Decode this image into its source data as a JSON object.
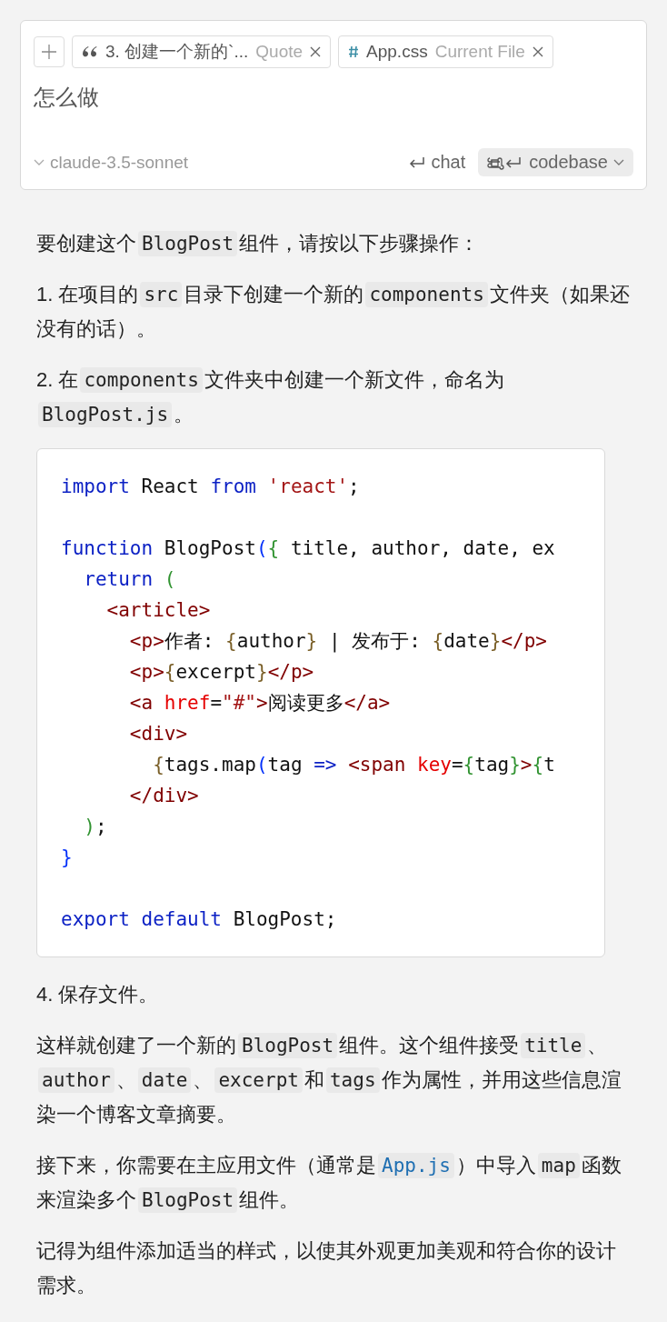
{
  "composer": {
    "chips": [
      {
        "kind": "quote",
        "label": "3. 创建一个新的`...",
        "tag": "Quote"
      },
      {
        "kind": "file",
        "label": "App.css",
        "tag": "Current File"
      }
    ],
    "message": "怎么做",
    "model": "claude-3.5-sonnet",
    "chat": "chat",
    "codebase": "codebase"
  },
  "paragraphs_before": [
    [
      {
        "kind": "text",
        "text": "要创建这个"
      },
      {
        "kind": "code",
        "text": "BlogPost"
      },
      {
        "kind": "text",
        "text": "组件，请按以下步骤操作："
      }
    ],
    [
      {
        "kind": "text",
        "text": "1. 在项目的"
      },
      {
        "kind": "code",
        "text": "src"
      },
      {
        "kind": "text",
        "text": "目录下创建一个新的"
      },
      {
        "kind": "code",
        "text": "components"
      },
      {
        "kind": "text",
        "text": "文件夹（如果还没有的话）。"
      }
    ],
    [
      {
        "kind": "text",
        "text": "2. 在"
      },
      {
        "kind": "code",
        "text": "components"
      },
      {
        "kind": "text",
        "text": "文件夹中创建一个新文件，命名为"
      },
      {
        "kind": "code",
        "text": "BlogPost.js"
      },
      {
        "kind": "text",
        "text": "。"
      }
    ]
  ],
  "code_blocks": [
    [
      [
        {
          "kind": "kw",
          "text": "import"
        },
        {
          "kind": "plain",
          "text": " React "
        },
        {
          "kind": "kw",
          "text": "from"
        },
        {
          "kind": "str",
          "text": " 'react'"
        },
        {
          "kind": "plain",
          "text": ";"
        }
      ]
    ],
    [
      [
        {
          "kind": "kw",
          "text": "function"
        },
        {
          "kind": "plain",
          "text": " BlogPost"
        },
        {
          "kind": "blue",
          "text": "("
        },
        {
          "kind": "green",
          "text": "{"
        },
        {
          "kind": "plain",
          "text": " title, author, date, ex"
        }
      ],
      [
        {
          "kind": "kw",
          "text": "  return"
        },
        {
          "kind": "green",
          "text": " ("
        }
      ],
      [
        {
          "kind": "tag",
          "text": "    <article>"
        }
      ],
      [
        {
          "kind": "tag",
          "text": "      <p>"
        },
        {
          "kind": "plain",
          "text": "作者: "
        },
        {
          "kind": "gold",
          "text": "{"
        },
        {
          "kind": "plain",
          "text": "author"
        },
        {
          "kind": "gold",
          "text": "}"
        },
        {
          "kind": "plain",
          "text": " | 发布于: "
        },
        {
          "kind": "gold",
          "text": "{"
        },
        {
          "kind": "plain",
          "text": "date"
        },
        {
          "kind": "gold",
          "text": "}"
        },
        {
          "kind": "tag",
          "text": "</p>"
        }
      ],
      [
        {
          "kind": "tag",
          "text": "      <p>"
        },
        {
          "kind": "gold",
          "text": "{"
        },
        {
          "kind": "plain",
          "text": "excerpt"
        },
        {
          "kind": "gold",
          "text": "}"
        },
        {
          "kind": "tag",
          "text": "</p>"
        }
      ],
      [
        {
          "kind": "tag",
          "text": "      <a"
        },
        {
          "kind": "attr",
          "text": " href"
        },
        {
          "kind": "plain",
          "text": "="
        },
        {
          "kind": "str",
          "text": "\"#\""
        },
        {
          "kind": "tag",
          "text": ">"
        },
        {
          "kind": "plain",
          "text": "阅读更多"
        },
        {
          "kind": "tag",
          "text": "</a>"
        }
      ],
      [
        {
          "kind": "tag",
          "text": "      <div>"
        }
      ],
      [
        {
          "kind": "gold",
          "text": "        {"
        },
        {
          "kind": "plain",
          "text": "tags.map"
        },
        {
          "kind": "blue",
          "text": "("
        },
        {
          "kind": "plain",
          "text": "tag"
        },
        {
          "kind": "kw",
          "text": " =>"
        },
        {
          "kind": "tag",
          "text": " <span"
        },
        {
          "kind": "attr",
          "text": " key"
        },
        {
          "kind": "plain",
          "text": "="
        },
        {
          "kind": "green",
          "text": "{"
        },
        {
          "kind": "plain",
          "text": "tag"
        },
        {
          "kind": "green",
          "text": "}"
        },
        {
          "kind": "tag",
          "text": ">"
        },
        {
          "kind": "green",
          "text": "{"
        },
        {
          "kind": "plain",
          "text": "t"
        }
      ],
      [
        {
          "kind": "tag",
          "text": "      </div>"
        }
      ],
      [
        {
          "kind": "green",
          "text": "  )"
        },
        {
          "kind": "plain",
          "text": ";"
        }
      ],
      [
        {
          "kind": "blue",
          "text": "}"
        }
      ]
    ],
    [
      [
        {
          "kind": "kw",
          "text": "export"
        },
        {
          "kind": "kw",
          "text": " default"
        },
        {
          "kind": "plain",
          "text": " BlogPost;"
        }
      ]
    ]
  ],
  "paragraphs_after": [
    [
      {
        "kind": "text",
        "text": "4. 保存文件。"
      }
    ],
    [
      {
        "kind": "text",
        "text": "这样就创建了一个新的"
      },
      {
        "kind": "code",
        "text": "BlogPost"
      },
      {
        "kind": "text",
        "text": "组件。这个组件接受"
      },
      {
        "kind": "code",
        "text": "title"
      },
      {
        "kind": "text",
        "text": "、"
      },
      {
        "kind": "code",
        "text": "author"
      },
      {
        "kind": "text",
        "text": "、"
      },
      {
        "kind": "code",
        "text": "date"
      },
      {
        "kind": "text",
        "text": "、"
      },
      {
        "kind": "code",
        "text": "excerpt"
      },
      {
        "kind": "text",
        "text": "和"
      },
      {
        "kind": "code",
        "text": "tags"
      },
      {
        "kind": "text",
        "text": "作为属性，并用这些信息渲染一个博客文章摘要。"
      }
    ],
    [
      {
        "kind": "text",
        "text": "接下来，你需要在主应用文件（通常是"
      },
      {
        "kind": "link",
        "text": "App.js"
      },
      {
        "kind": "text",
        "text": "）中导入"
      },
      {
        "kind": "code",
        "text": "map"
      },
      {
        "kind": "text",
        "text": "函数来渲染多个"
      },
      {
        "kind": "code",
        "text": "BlogPost"
      },
      {
        "kind": "text",
        "text": "组件。"
      }
    ],
    [
      {
        "kind": "text",
        "text": "记得为组件添加适当的样式，以使其外观更加美观和符合你的设计需求。"
      }
    ]
  ]
}
